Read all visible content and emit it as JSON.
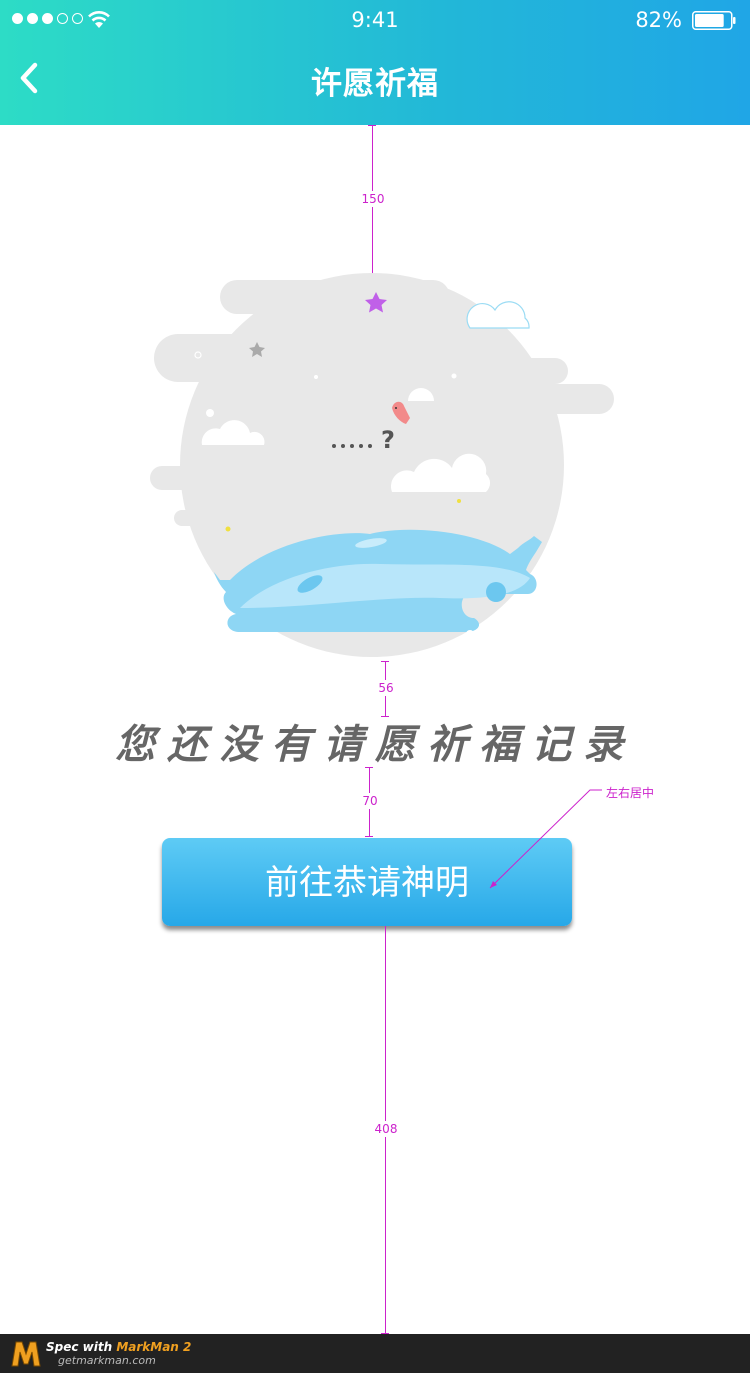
{
  "status_bar": {
    "time": "9:41",
    "battery_percent": "82%",
    "battery_level": 0.82,
    "signal_bars_filled": 3,
    "signal_bars_total": 5
  },
  "header": {
    "title": "许愿祈福"
  },
  "empty_state": {
    "message": "您还没有请愿祈福记录",
    "question_mark": "?"
  },
  "cta": {
    "label": "前往恭请神明"
  },
  "spec": {
    "dim_top": "150",
    "dim_illus_text": "56",
    "dim_text_button": "70",
    "dim_button_bottom": "408",
    "note": "左右居中"
  },
  "footer": {
    "brand_prefix": "Spec with ",
    "brand_name": "MarkMan 2",
    "url": "getmarkman.com"
  },
  "colors": {
    "header_start": "#2ddcc6",
    "header_end": "#20a6e6",
    "button": "#27a8e8",
    "annotation": "#cc22cc"
  }
}
